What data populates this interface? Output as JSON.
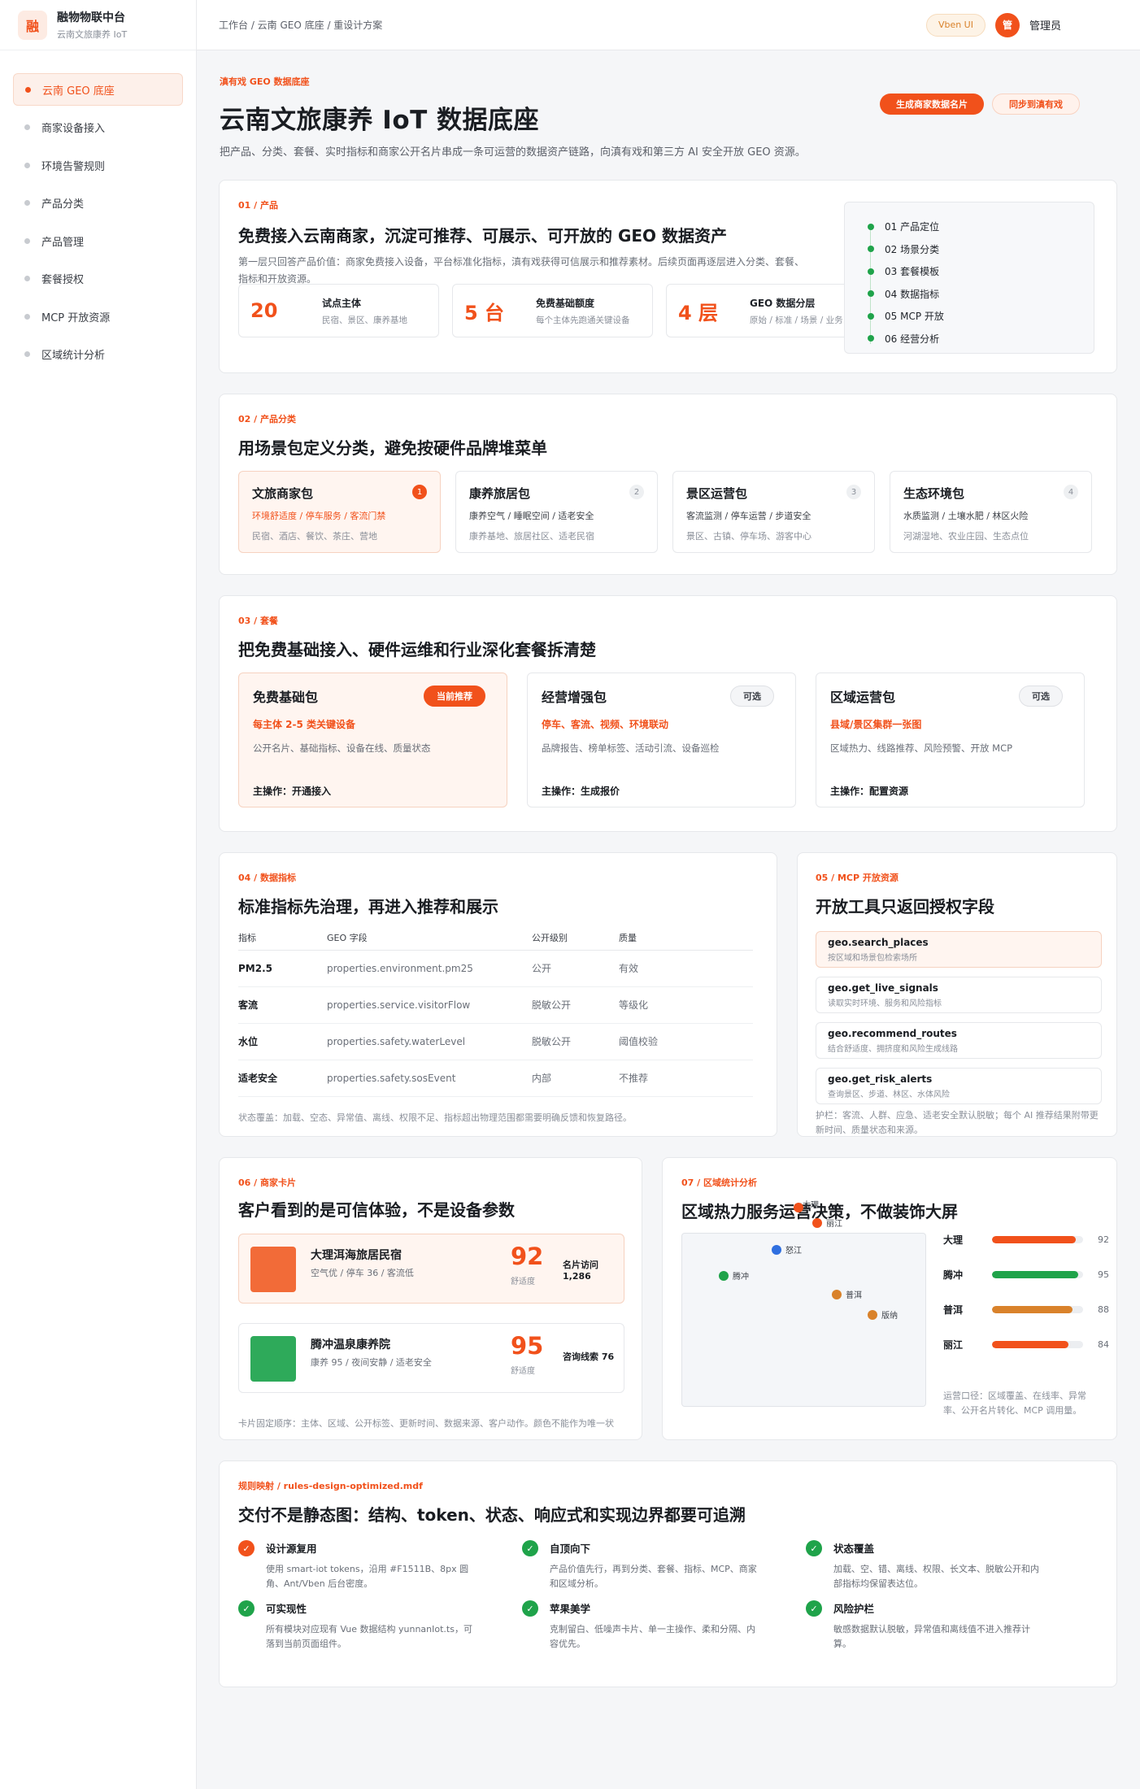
{
  "brand": {
    "logo": "融",
    "title": "融物物联中台",
    "subtitle": "云南文旅康养 IoT"
  },
  "menu": [
    "云南 GEO 底座",
    "商家设备接入",
    "环境告警规则",
    "产品分类",
    "产品管理",
    "套餐授权",
    "MCP 开放资源",
    "区域统计分析"
  ],
  "topbar": {
    "breadcrumb": "工作台 / 云南 GEO 底座 / 重设计方案",
    "chip": "Vben UI",
    "avatar": "管",
    "user": "管理员"
  },
  "hero": {
    "eyebrow": "滇有戏 GEO 数据底座",
    "title": "云南文旅康养 IoT 数据底座",
    "desc": "把产品、分类、套餐、实时指标和商家公开名片串成一条可运营的数据资产链路，向滇有戏和第三方 AI 安全开放 GEO 资源。",
    "btn_primary": "生成商家数据名片",
    "btn_secondary": "同步到滇有戏"
  },
  "s1": {
    "tag": "01 / 产品",
    "title": "免费接入云南商家，沉淀可推荐、可展示、可开放的 GEO 数据资产",
    "desc": "第一层只回答产品价值：商家免费接入设备，平台标准化指标，滇有戏获得可信展示和推荐素材。后续页面再逐层进入分类、套餐、指标和开放资源。",
    "stats": [
      {
        "value": "20",
        "label": "试点主体",
        "sub": "民宿、景区、康养基地"
      },
      {
        "value": "5 台",
        "label": "免费基础额度",
        "sub": "每个主体先跑通关键设备"
      },
      {
        "value": "4 层",
        "label": "GEO 数据分层",
        "sub": "原始 / 标准 / 场景 / 业务"
      }
    ],
    "steps": [
      "01  产品定位",
      "02  场景分类",
      "03  套餐模板",
      "04  数据指标",
      "05  MCP 开放",
      "06  经营分析"
    ]
  },
  "s2": {
    "tag": "02 / 产品分类",
    "title": "用场景包定义分类，避免按硬件品牌堆菜单",
    "packs": [
      {
        "title": "文旅商家包",
        "num": "1",
        "l1": "环境舒适度 / 停车服务 / 客流门禁",
        "l2": "民宿、酒店、餐饮、茶庄、营地"
      },
      {
        "title": "康养旅居包",
        "num": "2",
        "l1": "康养空气 / 睡眠空间 / 适老安全",
        "l2": "康养基地、旅居社区、适老民宿"
      },
      {
        "title": "景区运营包",
        "num": "3",
        "l1": "客流监测 / 停车运营 / 步道安全",
        "l2": "景区、古镇、停车场、游客中心"
      },
      {
        "title": "生态环境包",
        "num": "4",
        "l1": "水质监测 / 土壤水肥 / 林区火险",
        "l2": "河湖湿地、农业庄园、生态点位"
      }
    ]
  },
  "s3": {
    "tag": "03 / 套餐",
    "title": "把免费基础接入、硬件运维和行业深化套餐拆清楚",
    "plans": [
      {
        "title": "免费基础包",
        "badge": "当前推荐",
        "hl": "每主体 2-5 类关键设备",
        "desc": "公开名片、基础指标、设备在线、质量状态",
        "op": "主操作：开通接入"
      },
      {
        "title": "经营增强包",
        "badge": "可选",
        "hl": "停车、客流、视频、环境联动",
        "desc": "品牌报告、榜单标签、活动引流、设备巡检",
        "op": "主操作：生成报价"
      },
      {
        "title": "区域运营包",
        "badge": "可选",
        "hl": "县域/景区集群一张图",
        "desc": "区域热力、线路推荐、风险预警、开放 MCP",
        "op": "主操作：配置资源"
      }
    ]
  },
  "s4": {
    "tag": "04 / 数据指标",
    "title": "标准指标先治理，再进入推荐和展示",
    "headers": [
      "指标",
      "GEO 字段",
      "公开级别",
      "质量"
    ],
    "rows": [
      [
        "PM2.5",
        "properties.environment.pm25",
        "公开",
        "有效"
      ],
      [
        "客流",
        "properties.service.visitorFlow",
        "脱敏公开",
        "等级化"
      ],
      [
        "水位",
        "properties.safety.waterLevel",
        "脱敏公开",
        "阈值校验"
      ],
      [
        "适老安全",
        "properties.safety.sosEvent",
        "内部",
        "不推荐"
      ]
    ],
    "note": "状态覆盖：加载、空态、异常值、离线、权限不足、指标超出物理范围都需要明确反馈和恢复路径。"
  },
  "s5": {
    "tag": "05 / MCP 开放资源",
    "title": "开放工具只返回授权字段",
    "tools": [
      {
        "name": "geo.search_places",
        "desc": "按区域和场景包检索场所"
      },
      {
        "name": "geo.get_live_signals",
        "desc": "读取实时环境、服务和风险指标"
      },
      {
        "name": "geo.recommend_routes",
        "desc": "结合舒适度、拥挤度和风险生成线路"
      },
      {
        "name": "geo.get_risk_alerts",
        "desc": "查询景区、步道、林区、水体风险"
      }
    ],
    "note": "护栏：客流、人群、应急、适老安全默认脱敏；每个 AI 推荐结果附带更新时间、质量状态和来源。"
  },
  "s6": {
    "tag": "06 / 商家卡片",
    "title": "客户看到的是可信体验，不是设备参数",
    "cards": [
      {
        "name": "大理洱海旅居民宿",
        "sub": "空气优 / 停车 36 / 客流低",
        "score": "92",
        "score_label": "舒适度",
        "metric": "名片访问 1,286",
        "color": "#F26B38"
      },
      {
        "name": "腾冲温泉康养院",
        "sub": "康养 95 / 夜间安静 / 适老安全",
        "score": "95",
        "score_label": "舒适度",
        "metric": "咨询线索 76",
        "color": "#2EAA5A"
      }
    ],
    "note": "卡片固定顺序：主体、区域、公开标签、更新时间、数据来源、客户动作。颜色不能作为唯一状态。"
  },
  "s7": {
    "tag": "07 / 区域统计分析",
    "title": "区域热力服务运营决策，不做装饰大屏",
    "pins": [
      {
        "name": "大理",
        "color": "#F1511B"
      },
      {
        "name": "丽江",
        "color": "#F1511B"
      },
      {
        "name": "怒江",
        "color": "#2F6FE0"
      },
      {
        "name": "腾冲",
        "color": "#1FA34A"
      },
      {
        "name": "普洱",
        "color": "#D9822B"
      },
      {
        "name": "版纳",
        "color": "#D9822B"
      }
    ],
    "bars": [
      {
        "name": "大理",
        "value": 92,
        "color": "#F1511B"
      },
      {
        "name": "腾冲",
        "value": 95,
        "color": "#1FA34A"
      },
      {
        "name": "普洱",
        "value": 88,
        "color": "#D9822B"
      },
      {
        "name": "丽江",
        "value": 84,
        "color": "#F1511B"
      }
    ],
    "note": "运营口径：区域覆盖、在线率、异常率、公开名片转化、MCP 调用量。"
  },
  "s8": {
    "tag": "规则映射 / rules-design-optimized.mdf",
    "title": "交付不是静态图：结构、token、状态、响应式和实现边界都要可追溯",
    "rules": [
      {
        "title": "设计源复用",
        "desc": "使用 smart-iot tokens，沿用 #F1511B、8px 圆角、Ant/Vben 后台密度。"
      },
      {
        "title": "自顶向下",
        "desc": "产品价值先行，再到分类、套餐、指标、MCP、商家和区域分析。"
      },
      {
        "title": "状态覆盖",
        "desc": "加载、空、错、离线、权限、长文本、脱敏公开和内部指标均保留表达位。"
      },
      {
        "title": "可实现性",
        "desc": "所有模块对应现有 Vue 数据结构 yunnanIot.ts，可落到当前页面组件。"
      },
      {
        "title": "苹果美学",
        "desc": "克制留白、低噪声卡片、单一主操作、柔和分隔、内容优先。"
      },
      {
        "title": "风险护栏",
        "desc": "敏感数据默认脱敏，异常值和离线值不进入推荐计算。"
      }
    ]
  }
}
